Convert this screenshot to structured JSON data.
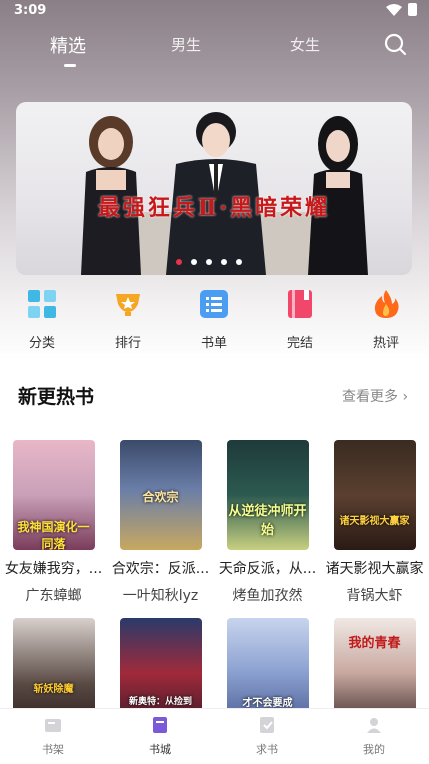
{
  "status_bar": {
    "time": "3:09"
  },
  "top_tabs": [
    {
      "label": "精选",
      "active": true
    },
    {
      "label": "男生",
      "active": false
    },
    {
      "label": "女生",
      "active": false
    }
  ],
  "banner": {
    "title": "最强狂兵Ⅱ·黑暗荣耀",
    "slide_count": 5,
    "active_slide": 1
  },
  "quick_entries": [
    {
      "label": "分类",
      "icon": "category-grid-icon",
      "color": "#3fb8e6"
    },
    {
      "label": "排行",
      "icon": "trophy-icon",
      "color": "#f5a623"
    },
    {
      "label": "书单",
      "icon": "list-icon",
      "color": "#4a9df0"
    },
    {
      "label": "完结",
      "icon": "book-icon",
      "color": "#f0476a"
    },
    {
      "label": "热评",
      "icon": "flame-icon",
      "color": "#ff6a1a"
    }
  ],
  "hot_section": {
    "title": "新更热书",
    "more_label": "查看更多",
    "books": [
      {
        "title": "女友嫌我穷，...",
        "author": "广东蟑螂",
        "cover_text": "我神国演化一同落"
      },
      {
        "title": "合欢宗：反派...",
        "author": "一叶知秋lyz",
        "cover_text": "合欢宗"
      },
      {
        "title": "天命反派，从...",
        "author": "烤鱼加孜然",
        "cover_text": "从逆徒冲师开始"
      },
      {
        "title": "诸天影视大赢家",
        "author": "背锅大虾",
        "cover_text": "诸天影视大赢家"
      }
    ],
    "books_row2": [
      {
        "cover_text": "斩妖除魔"
      },
      {
        "cover_text": "新奥特：从捡到"
      },
      {
        "cover_text": "才不会要成"
      },
      {
        "cover_text": "我的青春"
      }
    ]
  },
  "bottom_nav": [
    {
      "label": "书架",
      "icon": "bookshelf-icon",
      "active": false
    },
    {
      "label": "书城",
      "icon": "bookstore-icon",
      "active": true
    },
    {
      "label": "求书",
      "icon": "request-book-icon",
      "active": false
    },
    {
      "label": "我的",
      "icon": "profile-icon",
      "active": false
    }
  ]
}
